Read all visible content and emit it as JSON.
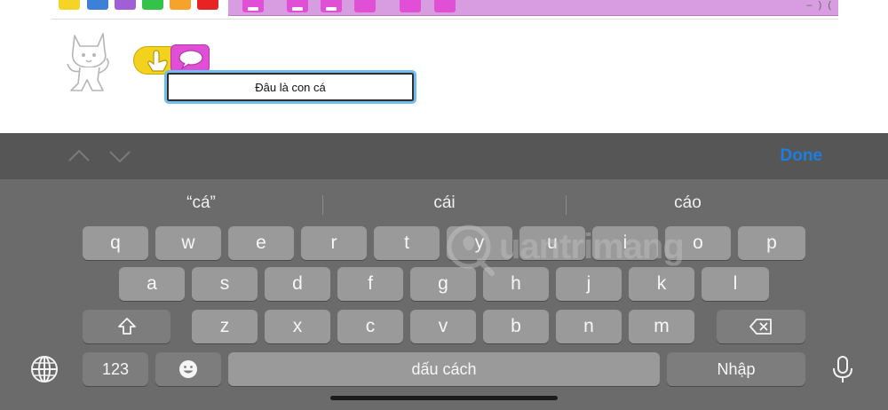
{
  "app": {
    "speech_bubble_text": "Đâu là con cá",
    "category_colors": [
      "#f5d425",
      "#3d80d8",
      "#a05fd6",
      "#33c24a",
      "#f7a22b",
      "#e82323"
    ],
    "icons": {
      "cat": "scratch-cat-sprite",
      "trigger_block": "tap-character-trigger-icon",
      "say_block": "speech-bubble-icon"
    }
  },
  "keyboard_toolbar": {
    "done_label": "Done"
  },
  "keyboard": {
    "suggestions": [
      "“cá”",
      "cái",
      "cáo"
    ],
    "row1": [
      "q",
      "w",
      "e",
      "r",
      "t",
      "y",
      "u",
      "i",
      "o",
      "p"
    ],
    "row2": [
      "a",
      "s",
      "d",
      "f",
      "g",
      "h",
      "j",
      "k",
      "l"
    ],
    "row3": [
      "z",
      "x",
      "c",
      "v",
      "b",
      "n",
      "m"
    ],
    "numbers_label": "123",
    "space_label": "dấu cách",
    "return_label": "Nhập"
  },
  "watermark": {
    "text": "uantrimang"
  }
}
